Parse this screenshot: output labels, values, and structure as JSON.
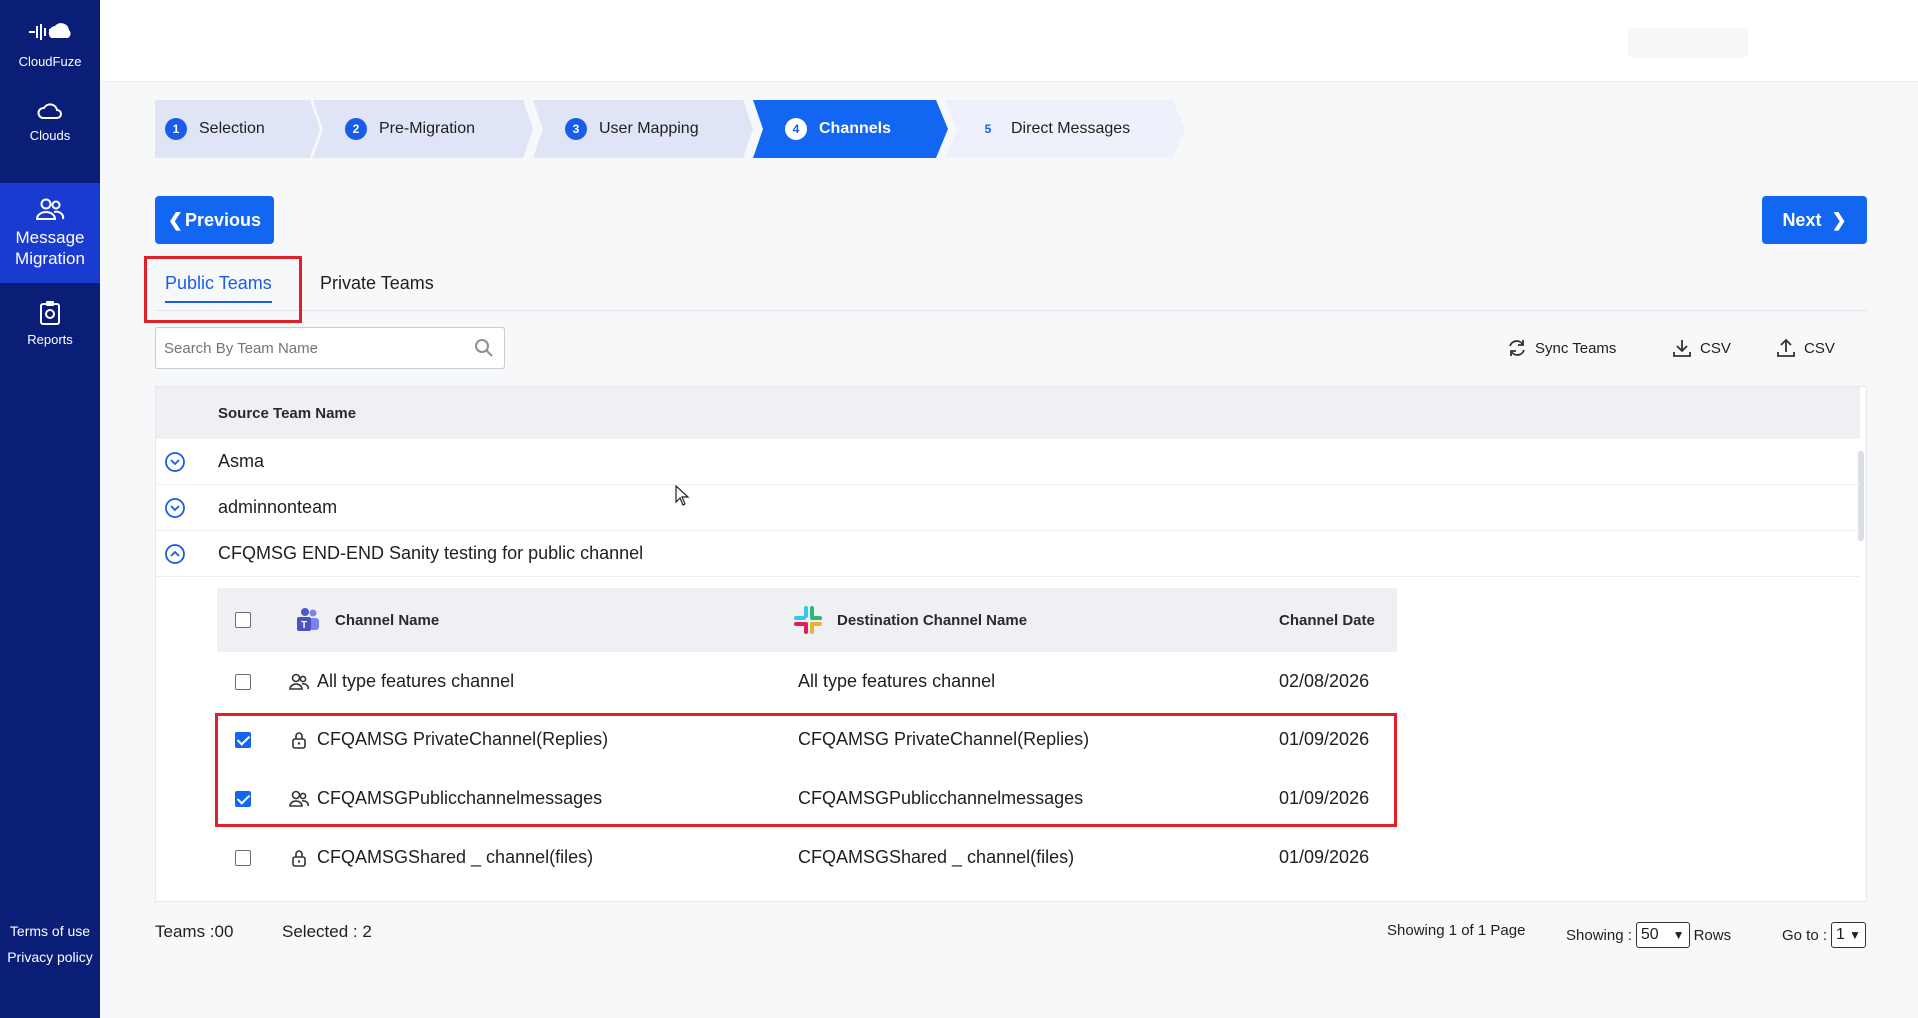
{
  "app": {
    "brand": "CloudFuze"
  },
  "sidebar": {
    "items": [
      {
        "label": "Clouds",
        "icon": "cloud-icon"
      },
      {
        "label": "Message Migration",
        "icon": "users-icon",
        "active": true
      },
      {
        "label": "Reports",
        "icon": "clipboard-icon"
      }
    ],
    "footer": {
      "terms": "Terms of use",
      "privacy": "Privacy policy"
    }
  },
  "steps": [
    {
      "num": "1",
      "label": "Selection",
      "state": "done"
    },
    {
      "num": "2",
      "label": "Pre-Migration",
      "state": "done"
    },
    {
      "num": "3",
      "label": "User Mapping",
      "state": "done"
    },
    {
      "num": "4",
      "label": "Channels",
      "state": "active"
    },
    {
      "num": "5",
      "label": "Direct Messages",
      "state": "todo"
    }
  ],
  "actions": {
    "previous": "Previous",
    "next": "Next"
  },
  "tabs": {
    "public": "Public Teams",
    "private": "Private Teams"
  },
  "search": {
    "placeholder": "Search By Team Name",
    "value": ""
  },
  "toolbar": {
    "sync": "Sync Teams",
    "download_csv": "CSV",
    "upload_csv": "CSV"
  },
  "table": {
    "header": "Source Team Name",
    "teams": [
      {
        "name": "Asma",
        "expanded": false
      },
      {
        "name": "adminnonteam",
        "expanded": false
      },
      {
        "name": "CFQMSG END-END Sanity testing for public channel",
        "expanded": true
      }
    ]
  },
  "channels": {
    "headers": {
      "name": "Channel Name",
      "destination": "Destination Channel Name",
      "date": "Channel Date"
    },
    "rows": [
      {
        "type": "public",
        "name": "All type features channel",
        "destination": "All type features channel",
        "date": "02/08/2026",
        "checked": false
      },
      {
        "type": "private",
        "name": "CFQAMSG PrivateChannel(Replies)",
        "destination": "CFQAMSG PrivateChannel(Replies)",
        "date": "01/09/2026",
        "checked": true
      },
      {
        "type": "public",
        "name": "CFQAMSGPublicchannelmessages",
        "destination": "CFQAMSGPublicchannelmessages",
        "date": "01/09/2026",
        "checked": true
      },
      {
        "type": "private",
        "name": "CFQAMSGShared _ channel(files)",
        "destination": "CFQAMSGShared _ channel(files)",
        "date": "01/09/2026",
        "checked": false
      }
    ]
  },
  "footer": {
    "teams": "Teams :00",
    "selected": "Selected : 2",
    "showing_pages": "Showing 1 of 1 Page",
    "showing_label": "Showing :",
    "rows_value": "50",
    "rows_label": "Rows",
    "goto_label": "Go to :",
    "goto_value": "1"
  },
  "colors": {
    "sidebar": "#0a1e78",
    "accent": "#1266f1",
    "highlight": "#e0202a"
  }
}
